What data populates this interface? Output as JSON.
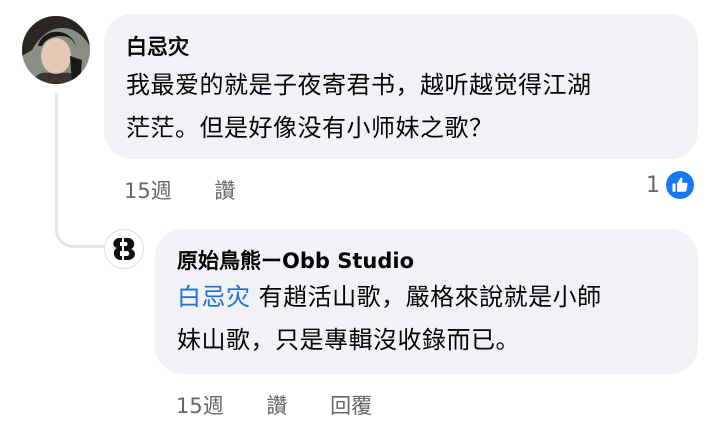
{
  "comment": {
    "author": "白忌灾",
    "text_line1": "我最爱的就是子夜寄君书，越听越觉得江湖",
    "text_line2": "茫茫。但是好像没有小师妹之歌？",
    "time": "15週",
    "like_label": "讚",
    "reaction_count": "1",
    "reaction_icon": "thumbs-up-icon"
  },
  "reply": {
    "author": "原始鳥熊ーObb Studio",
    "mention": "白忌灾",
    "text_line1_rest": " 有趙活山歌，嚴格來說就是小師",
    "text_line2": "妹山歌，只是專輯沒收錄而已。",
    "time": "15週",
    "like_label": "讚",
    "reply_label": "回覆"
  },
  "colors": {
    "bubble": "#f0f2f5",
    "mention": "#216fdb",
    "meta": "#65676b",
    "like_blue": "#1877f2"
  }
}
